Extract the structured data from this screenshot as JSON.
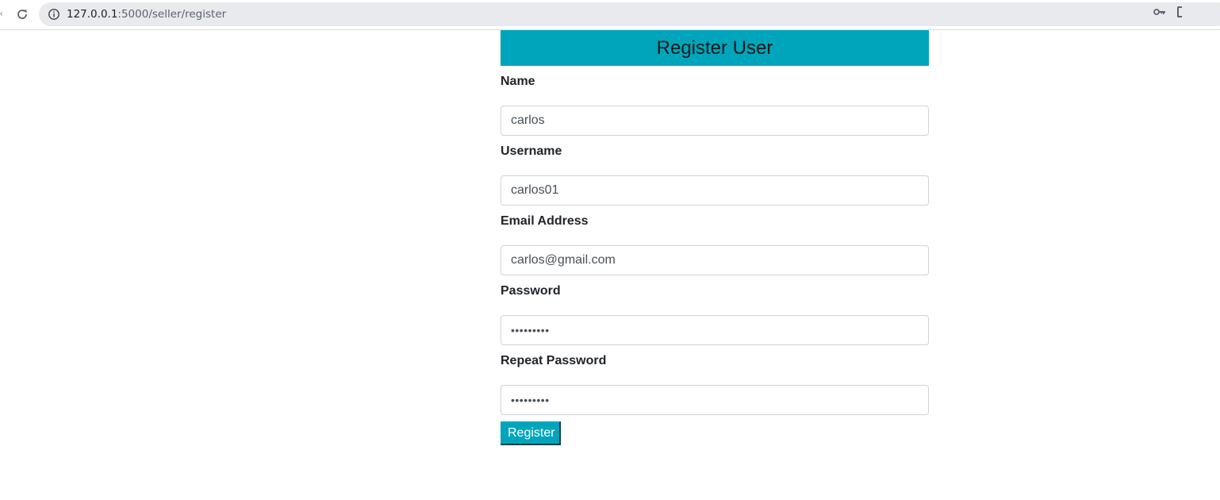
{
  "browser": {
    "url_host": "127.0.0.1",
    "url_path": ":5000/seller/register",
    "icons": [
      "reload-icon",
      "info-icon",
      "key-icon"
    ]
  },
  "form": {
    "title": "Register User",
    "fields": [
      {
        "label": "Name",
        "value": "carlos",
        "type": "text"
      },
      {
        "label": "Username",
        "value": "carlos01",
        "type": "text"
      },
      {
        "label": "Email Address",
        "value": "carlos@gmail.com",
        "type": "email"
      },
      {
        "label": "Password",
        "value": "•••••••••",
        "type": "password"
      },
      {
        "label": "Repeat Password",
        "value": "•••••••••",
        "type": "password"
      }
    ],
    "submit_label": "Register"
  },
  "colors": {
    "accent": "#00a5bb",
    "button_text": "#ffffff",
    "omnibox_bg": "#e8eaed"
  }
}
